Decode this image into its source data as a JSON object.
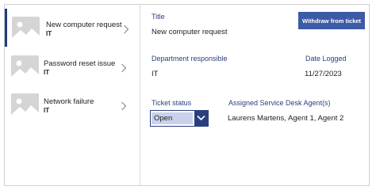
{
  "list": {
    "items": [
      {
        "title": "New computer request",
        "subtitle": "IT",
        "icon": "image-placeholder-icon"
      },
      {
        "title": "Password reset issue",
        "subtitle": "IT",
        "icon": "image-placeholder-icon"
      },
      {
        "title": "Network failure",
        "subtitle": "IT",
        "icon": "image-placeholder-icon"
      }
    ]
  },
  "detail": {
    "withdraw_label": "Withdraw from ticket",
    "title_label": "Title",
    "title_value": "New computer request",
    "department_label": "Department responsible",
    "department_value": "IT",
    "date_label": "Date Logged",
    "date_value": "11/27/2023",
    "status_label": "Ticket status",
    "status_value": "Open",
    "agents_label": "Assigned Service Desk Agent(s)",
    "agents_value": "Laurens Martens, Agent 1, Agent 2"
  },
  "colors": {
    "accent": "#3c5aa6",
    "label": "#2a3f7e",
    "selection": "#c9d2ea"
  }
}
